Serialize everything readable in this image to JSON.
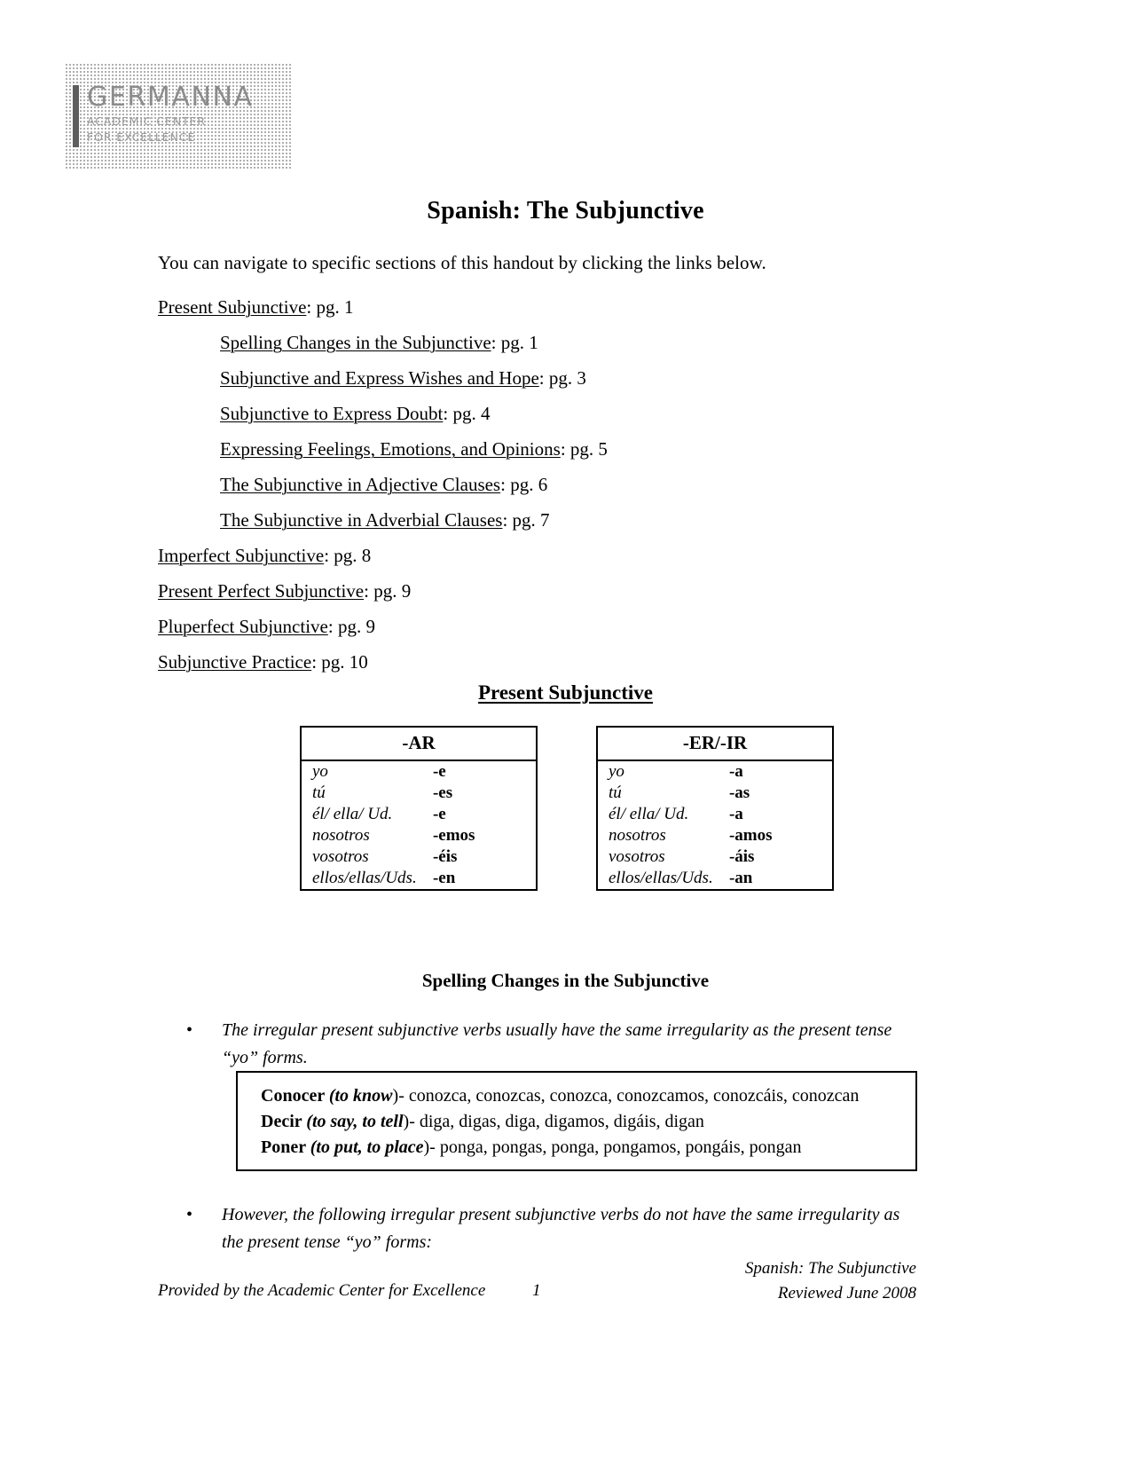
{
  "logo": {
    "name": "GERMANNA",
    "line1": "ACADEMIC CENTER",
    "line2": "FOR EXCELLENCE"
  },
  "document": {
    "title": "Spanish: The Subjunctive",
    "intro": "You can navigate to specific sections of this handout by clicking the links below."
  },
  "toc": [
    {
      "label": "Present Subjunctive",
      "page": ": pg. 1",
      "indent": false
    },
    {
      "label": "Spelling Changes in the Subjunctive",
      "page": ": pg. 1",
      "indent": true
    },
    {
      "label": "Subjunctive and Express Wishes and Hope",
      "page": ": pg. 3",
      "indent": true
    },
    {
      "label": "Subjunctive to Express Doubt",
      "page": ": pg. 4",
      "indent": true
    },
    {
      "label": "Expressing Feelings, Emotions, and Opinions",
      "page": ": pg. 5",
      "indent": true
    },
    {
      "label": "The Subjunctive in Adjective Clauses",
      "page": ": pg. 6",
      "indent": true
    },
    {
      "label": "The Subjunctive in Adverbial Clauses",
      "page": ": pg. 7",
      "indent": true
    },
    {
      "label": "Imperfect Subjunctive",
      "page": ": pg. 8",
      "indent": false
    },
    {
      "label": "Present Perfect Subjunctive",
      "page": ": pg. 9",
      "indent": false
    },
    {
      "label": "Pluperfect Subjunctive",
      "page": ": pg. 9",
      "indent": false
    },
    {
      "label": "Subjunctive Practice",
      "page": ": pg. 10",
      "indent": false
    }
  ],
  "present_subjunctive": {
    "heading": "Present Subjunctive",
    "table_ar": {
      "header": "-AR",
      "rows": [
        {
          "pronoun": "yo",
          "ending": "-e"
        },
        {
          "pronoun": "tú",
          "ending": "-es"
        },
        {
          "pronoun": "él/ ella/ Ud.",
          "ending": "-e"
        },
        {
          "pronoun": "nosotros",
          "ending": "-emos"
        },
        {
          "pronoun": "vosotros",
          "ending": "-éis"
        },
        {
          "pronoun": "ellos/ellas/Uds.",
          "ending": "-en"
        }
      ]
    },
    "table_erir": {
      "header": "-ER/-IR",
      "rows": [
        {
          "pronoun": "yo",
          "ending": "-a"
        },
        {
          "pronoun": "tú",
          "ending": "-as"
        },
        {
          "pronoun": "él/ ella/ Ud.",
          "ending": "-a"
        },
        {
          "pronoun": "nosotros",
          "ending": "-amos"
        },
        {
          "pronoun": "vosotros",
          "ending": "-áis"
        },
        {
          "pronoun": "ellos/ellas/Uds.",
          "ending": "-an"
        }
      ]
    }
  },
  "spelling_changes": {
    "heading": "Spelling Changes in the Subjunctive",
    "bullet_1": "The irregular present subjunctive verbs usually have the same irregularity as the present tense “yo” forms.",
    "bullet_2": "However, the following irregular present subjunctive verbs do not have the same irregularity as the present tense “yo” forms:",
    "verbs": [
      {
        "name": "Conocer ",
        "gloss": "(to know",
        "forms": ")- conozca, conozcas, conozca, conozcamos, conozcáis, conozcan"
      },
      {
        "name": "Decir ",
        "gloss": "(to say, to tell",
        "forms": ")- diga, digas, diga, digamos, digáis, digan"
      },
      {
        "name": "Poner ",
        "gloss": "(to put, to place",
        "forms": ")- ponga, pongas, ponga, pongamos, pongáis, pongan"
      }
    ]
  },
  "footer": {
    "left": "Provided by the Academic Center for Excellence",
    "page_number": "1",
    "right_line1": "Spanish: The Subjunctive",
    "right_line2": "Reviewed June 2008"
  },
  "icons": {
    "bullet": "•"
  }
}
